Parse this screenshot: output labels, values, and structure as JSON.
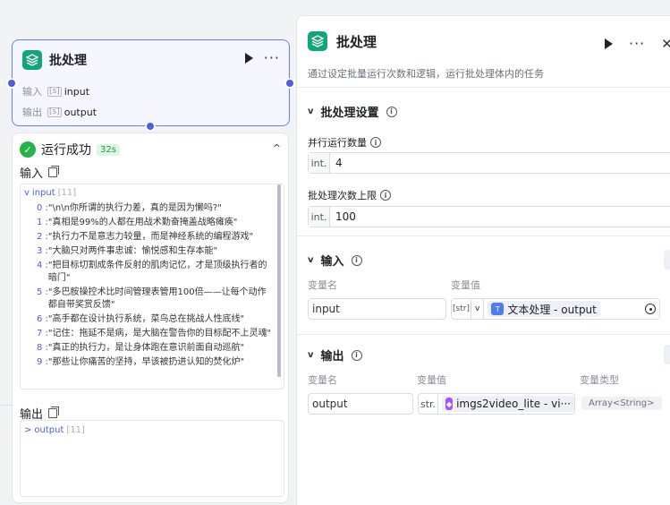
{
  "node": {
    "title": "批处理",
    "input_key": "输入",
    "input_value": "input",
    "output_key": "输出",
    "output_value": "output"
  },
  "result": {
    "status": "运行成功",
    "time": "32s",
    "input_label": "输入",
    "output_label": "输出",
    "input_root": "input",
    "input_count": "[11]",
    "output_root": "output",
    "output_count": "[11]",
    "items": [
      {
        "idx": "0 : ",
        "val": "\"\\n\\n你所谓的执行力差，真的是因为懒吗?\""
      },
      {
        "idx": "1 : ",
        "val": "\"真相是99%的人都在用战术勤奋掩盖战略瘫痪\""
      },
      {
        "idx": "2 : ",
        "val": "\"执行力不是意志力较量，而是神经系统的编程游戏\""
      },
      {
        "idx": "3 : ",
        "val": "\"大脑只对两件事忠诚：愉悦感和生存本能\""
      },
      {
        "idx": "4 : ",
        "val": "\"把目标切割成条件反射的肌肉记忆，才是顶级执行者的暗门\""
      },
      {
        "idx": "5 : ",
        "val": "\"多巴胺操控术比时间管理表管用100倍——让每个动作都自带奖赏反馈\""
      },
      {
        "idx": "6 : ",
        "val": "\"高手都在设计执行系统，菜鸟总在挑战人性底线\""
      },
      {
        "idx": "7 : ",
        "val": "\"记住：拖延不是病，是大脑在警告你的目标配不上灵魂\""
      },
      {
        "idx": "8 : ",
        "val": "\"真正的执行力，是让身体跑在意识前面自动巡航\""
      },
      {
        "idx": "9 : ",
        "val": "\"那些让你痛苦的坚持，早该被扔进认知的焚化炉\""
      }
    ]
  },
  "panel": {
    "title": "批处理",
    "description": "通过设定批量运行次数和逻辑，运行批处理体内的任务",
    "settings_title": "批处理设置",
    "parallel_label": "并行运行数量",
    "parallel_prefix": "int.",
    "parallel_value": "4",
    "max_label": "批处理次数上限",
    "max_prefix": "int.",
    "max_value": "100",
    "input_section": "输入",
    "var_name_hdr": "变量名",
    "var_value_hdr": "变量值",
    "input_var_name": "input",
    "input_type": "[str]",
    "input_ref": "文本处理 - output",
    "output_section": "输出",
    "out_var_name_hdr": "变量名",
    "out_var_value_hdr": "变量值",
    "out_var_type_hdr": "变量类型",
    "output_var_name": "output",
    "output_type": "str.",
    "output_ref": "imgs2video_lite - vi···",
    "output_var_type": "Array<String>"
  },
  "colors": {
    "accent": "#4a5de6",
    "success": "#27b24a",
    "node_icon": "#10a67a"
  }
}
